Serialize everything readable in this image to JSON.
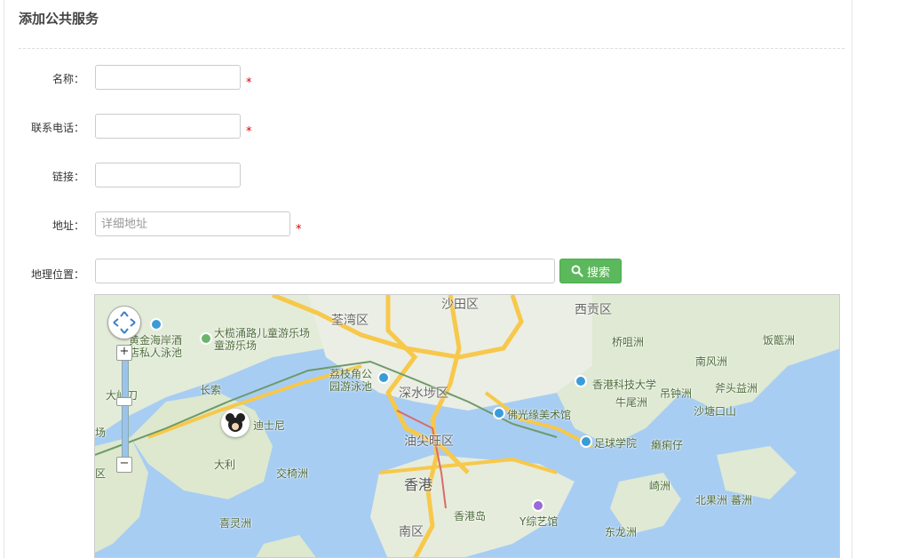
{
  "page": {
    "title": "添加公共服务"
  },
  "form": {
    "name_label": "名称：",
    "phone_label": "联系电话：",
    "link_label": "链接：",
    "address_label": "地址：",
    "address_placeholder": "详细地址",
    "geo_label": "地理位置：",
    "required_mark": "*",
    "search_button": "搜索"
  },
  "map": {
    "labels": {
      "shatin": "沙田区",
      "tsuen_wan": "荃湾区",
      "sai_kung": "西贡区",
      "kingsmen": "大榄涌路儿童游乐场",
      "kingsmen2": "童游乐场",
      "gold_coast": "黄金海岸酒",
      "gold_coast2": "店私人泳池",
      "lai_chi_kok": "荔枝角公",
      "lai_chi_kok2": "园游泳池",
      "sham_shui_po": "深水埗区",
      "yau_tsim_mong": "油尖旺区",
      "hong_kong": "香港",
      "disney": "迪士尼",
      "cheung_so": "长索",
      "tai_lei": "大利",
      "kau_chau": "交椅洲",
      "hei_ling": "喜灵洲",
      "southern": "南区",
      "hk_island": "香港岛",
      "y_variety": "Y综艺馆",
      "ust": "香港科技大学",
      "fo_guang": "佛光缘美术馆",
      "football": "足球学院",
      "kiu_tsui": "桥咀洲",
      "nam_fung": "南风洲",
      "fan_kaw": "饭甑洲",
      "ngau_mei": "牛尾洲",
      "tiu_chung": "吊钟洲",
      "fu_tau": "斧头益洲",
      "sha_tong": "沙塘口山",
      "lai_ngam": "癞痢仔",
      "kei": "崎洲",
      "pak_kwo": "北果洲",
      "ship": "蕃洲",
      "tung_lung": "东龙洲",
      "tai_ngong": "大屿刀",
      "yard": "场",
      "tin_ma": "区"
    }
  }
}
